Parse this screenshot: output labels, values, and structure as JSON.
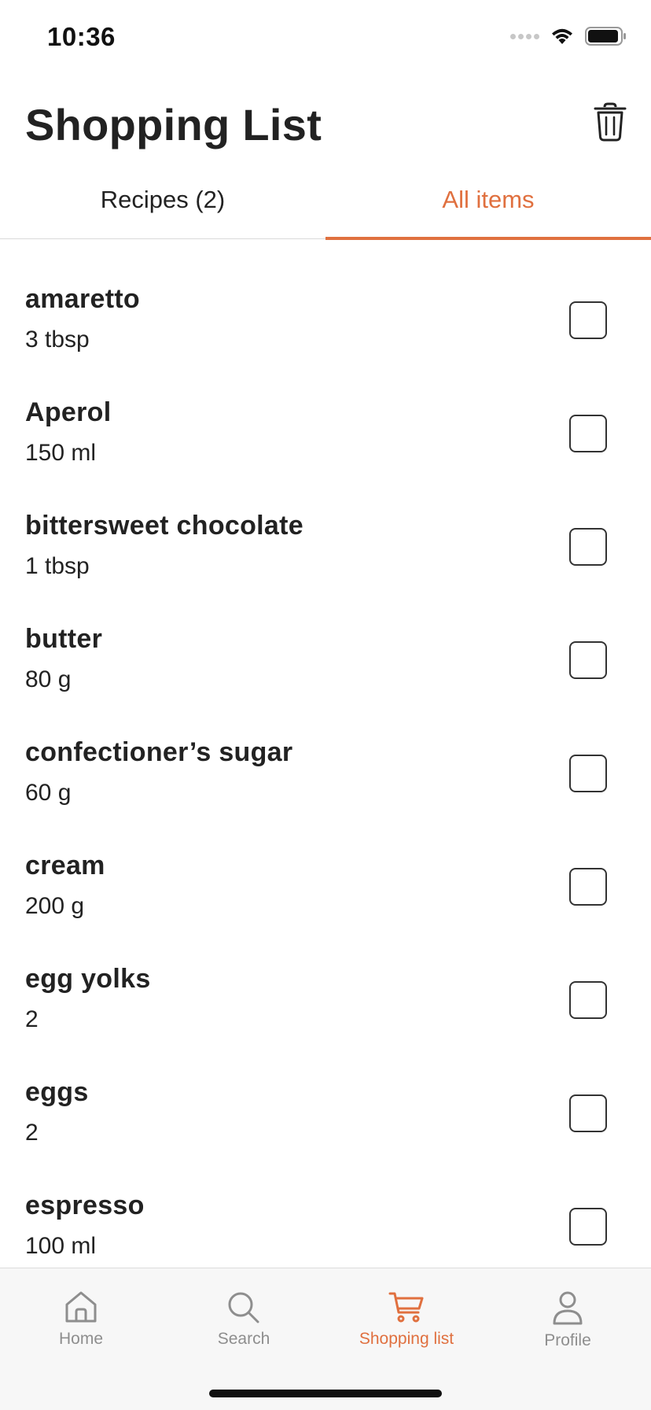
{
  "status": {
    "time": "10:36"
  },
  "header": {
    "title": "Shopping List"
  },
  "tabs": [
    {
      "label": "Recipes (2)",
      "active": false
    },
    {
      "label": "All items",
      "active": true
    }
  ],
  "items": [
    {
      "name": "amaretto",
      "qty": "3 tbsp",
      "checked": false
    },
    {
      "name": "Aperol",
      "qty": "150 ml",
      "checked": false
    },
    {
      "name": "bittersweet chocolate",
      "qty": "1 tbsp",
      "checked": false
    },
    {
      "name": "butter",
      "qty": "80 g",
      "checked": false
    },
    {
      "name": "confectioner’s sugar",
      "qty": "60 g",
      "checked": false
    },
    {
      "name": "cream",
      "qty": "200 g",
      "checked": false
    },
    {
      "name": "egg yolks",
      "qty": "2",
      "checked": false
    },
    {
      "name": "eggs",
      "qty": "2",
      "checked": false
    },
    {
      "name": "espresso",
      "qty": "100 ml",
      "checked": false
    }
  ],
  "nav": [
    {
      "label": "Home",
      "icon": "home-icon",
      "active": false
    },
    {
      "label": "Search",
      "icon": "search-icon",
      "active": false
    },
    {
      "label": "Shopping list",
      "icon": "cart-icon",
      "active": true
    },
    {
      "label": "Profile",
      "icon": "profile-icon",
      "active": false
    }
  ],
  "colors": {
    "accent": "#e0703f",
    "text": "#222222",
    "inactive": "#8e8e8e",
    "tabbar_bg": "#f7f7f7"
  }
}
